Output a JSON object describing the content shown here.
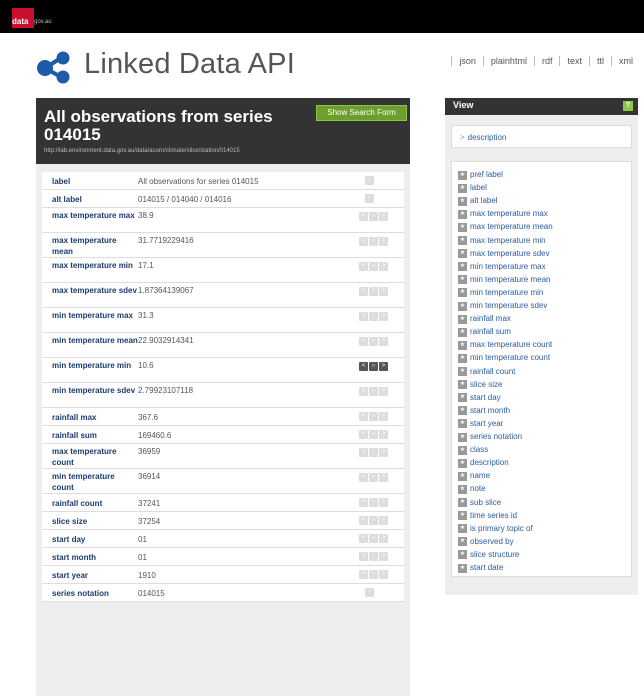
{
  "site": {
    "logo_text": "data",
    "logo_sub": "gov.au"
  },
  "brand": {
    "title": "Linked Data API"
  },
  "formats": [
    "json",
    "plainhtml",
    "rdf",
    "text",
    "ttl",
    "xml"
  ],
  "panel": {
    "title": "All observations from series 014015",
    "url": "http://lab.environment.data.gov.au/data/acorn/climate/slice/station/014015",
    "search_button": "Show Search Form"
  },
  "rows": [
    {
      "label": "label",
      "value": "All observations for series 014015"
    },
    {
      "label": "alt label",
      "value": "014015 / 014040 / 014016"
    },
    {
      "label": "max temperature max",
      "value": "38.9"
    },
    {
      "label": "max temperature mean",
      "value": "31.7719229416"
    },
    {
      "label": "max temperature min",
      "value": "17.1"
    },
    {
      "label": "max temperature sdev",
      "value": "1.87364139067"
    },
    {
      "label": "min temperature max",
      "value": "31.3"
    },
    {
      "label": "min temperature mean",
      "value": "22.9032914341"
    },
    {
      "label": "min temperature min",
      "value": "10.6"
    },
    {
      "label": "min temperature sdev",
      "value": "2.79923107118"
    },
    {
      "label": "rainfall max",
      "value": "367.6"
    },
    {
      "label": "rainfall sum",
      "value": "169460.6"
    },
    {
      "label": "max temperature count",
      "value": "36959"
    },
    {
      "label": "min temperature count",
      "value": "36914"
    },
    {
      "label": "rainfall count",
      "value": "37241"
    },
    {
      "label": "slice size",
      "value": "37254"
    },
    {
      "label": "start day",
      "value": "01"
    },
    {
      "label": "start month",
      "value": "01"
    },
    {
      "label": "start year",
      "value": "1910"
    },
    {
      "label": "series notation",
      "value": "014015"
    }
  ],
  "view": {
    "title": "View",
    "help": "?",
    "description": "description",
    "properties": [
      "pref label",
      "label",
      "alt label",
      "max temperature max",
      "max temperature mean",
      "max temperature min",
      "max temperature sdev",
      "min temperature max",
      "min temperature mean",
      "min temperature min",
      "min temperature sdev",
      "rainfall max",
      "rainfall sum",
      "max temperature count",
      "min temperature count",
      "rainfall count",
      "slice size",
      "start day",
      "start month",
      "start year",
      "series notation",
      "class",
      "description",
      "name",
      "note",
      "sub slice",
      "time series id",
      "is primary topic of",
      "observed by",
      "slice structure",
      "start date"
    ]
  }
}
